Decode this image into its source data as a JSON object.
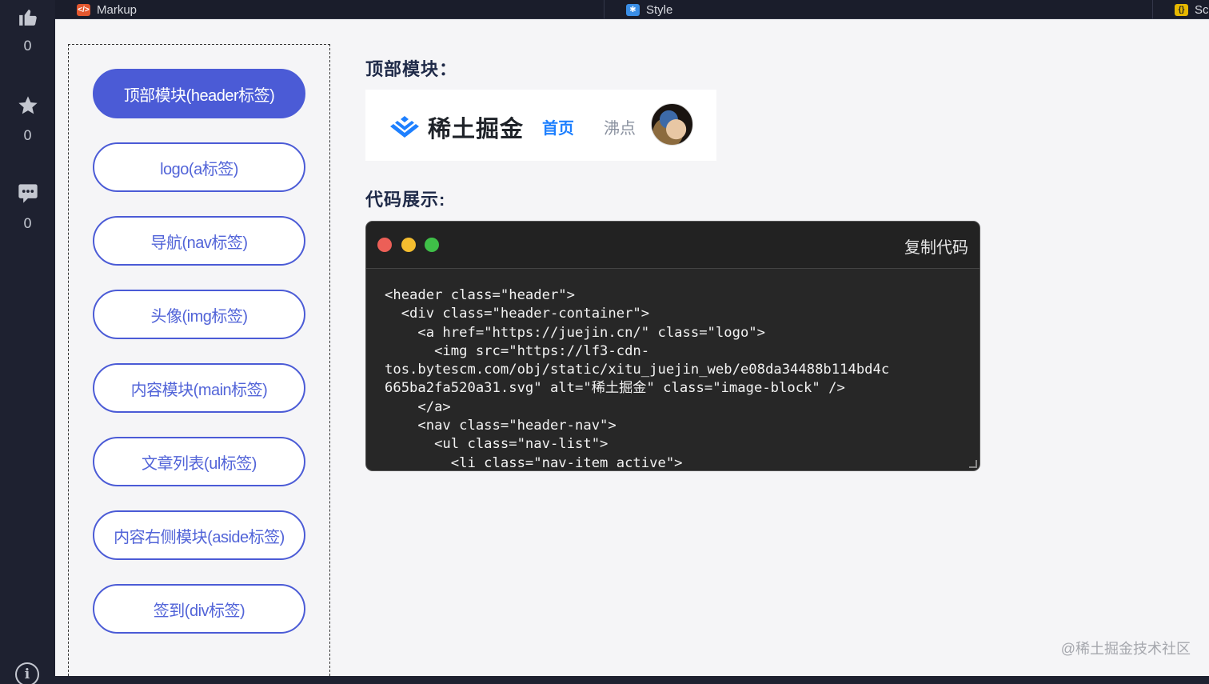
{
  "rail": {
    "likes": "0",
    "stars": "0",
    "comments": "0",
    "info_symbol": "i"
  },
  "tabs": [
    {
      "badge": "</>",
      "label": "Markup",
      "color": "#e2572f"
    },
    {
      "badge": "✱",
      "label": "Style",
      "color": "#3a8ee6"
    },
    {
      "badge": "{}",
      "label": "Sc",
      "color": "#e6b800"
    }
  ],
  "menu": {
    "items": [
      "顶部模块(header标签)",
      "logo(a标签)",
      "导航(nav标签)",
      "头像(img标签)",
      "内容模块(main标签)",
      "文章列表(ul标签)",
      "内容右侧模块(aside标签)",
      "签到(div标签)"
    ],
    "active_index": 0
  },
  "preview": {
    "section_title": "顶部模块：",
    "logo_text": "稀土掘金",
    "nav_home": "首页",
    "nav_hot": "沸点"
  },
  "code": {
    "section_title": "代码展示:",
    "copy_label": "复制代码",
    "content": "<header class=\"header\">\n  <div class=\"header-container\">\n    <a href=\"https://juejin.cn/\" class=\"logo\">\n      <img src=\"https://lf3-cdn-\ntos.bytescm.com/obj/static/xitu_juejin_web/e08da34488b114bd4c\n665ba2fa520a31.svg\" alt=\"稀土掘金\" class=\"image-block\" />\n    </a>\n    <nav class=\"header-nav\">\n      <ul class=\"nav-list\">\n        <li class=\"nav-item active\">"
  },
  "watermark": "@稀土掘金技术社区",
  "colors": {
    "accent": "#4b5bd6",
    "link": "#1e80ff",
    "sidebar_bg": "#1e2130"
  }
}
